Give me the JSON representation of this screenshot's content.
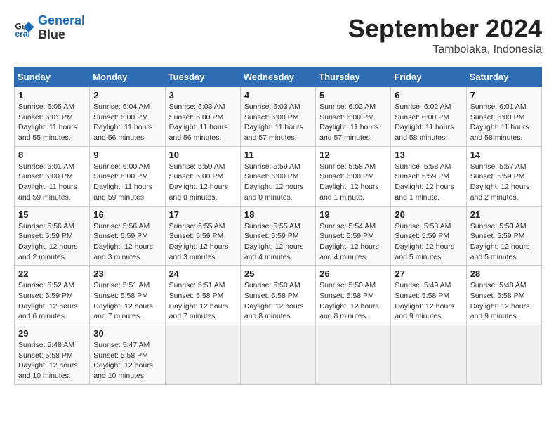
{
  "header": {
    "logo_line1": "General",
    "logo_line2": "Blue",
    "month": "September 2024",
    "location": "Tambolaka, Indonesia"
  },
  "weekdays": [
    "Sunday",
    "Monday",
    "Tuesday",
    "Wednesday",
    "Thursday",
    "Friday",
    "Saturday"
  ],
  "weeks": [
    [
      {
        "day": "1",
        "info": "Sunrise: 6:05 AM\nSunset: 6:01 PM\nDaylight: 11 hours\nand 55 minutes."
      },
      {
        "day": "2",
        "info": "Sunrise: 6:04 AM\nSunset: 6:00 PM\nDaylight: 11 hours\nand 56 minutes."
      },
      {
        "day": "3",
        "info": "Sunrise: 6:03 AM\nSunset: 6:00 PM\nDaylight: 11 hours\nand 56 minutes."
      },
      {
        "day": "4",
        "info": "Sunrise: 6:03 AM\nSunset: 6:00 PM\nDaylight: 11 hours\nand 57 minutes."
      },
      {
        "day": "5",
        "info": "Sunrise: 6:02 AM\nSunset: 6:00 PM\nDaylight: 11 hours\nand 57 minutes."
      },
      {
        "day": "6",
        "info": "Sunrise: 6:02 AM\nSunset: 6:00 PM\nDaylight: 11 hours\nand 58 minutes."
      },
      {
        "day": "7",
        "info": "Sunrise: 6:01 AM\nSunset: 6:00 PM\nDaylight: 11 hours\nand 58 minutes."
      }
    ],
    [
      {
        "day": "8",
        "info": "Sunrise: 6:01 AM\nSunset: 6:00 PM\nDaylight: 11 hours\nand 59 minutes."
      },
      {
        "day": "9",
        "info": "Sunrise: 6:00 AM\nSunset: 6:00 PM\nDaylight: 11 hours\nand 59 minutes."
      },
      {
        "day": "10",
        "info": "Sunrise: 5:59 AM\nSunset: 6:00 PM\nDaylight: 12 hours\nand 0 minutes."
      },
      {
        "day": "11",
        "info": "Sunrise: 5:59 AM\nSunset: 6:00 PM\nDaylight: 12 hours\nand 0 minutes."
      },
      {
        "day": "12",
        "info": "Sunrise: 5:58 AM\nSunset: 6:00 PM\nDaylight: 12 hours\nand 1 minute."
      },
      {
        "day": "13",
        "info": "Sunrise: 5:58 AM\nSunset: 5:59 PM\nDaylight: 12 hours\nand 1 minute."
      },
      {
        "day": "14",
        "info": "Sunrise: 5:57 AM\nSunset: 5:59 PM\nDaylight: 12 hours\nand 2 minutes."
      }
    ],
    [
      {
        "day": "15",
        "info": "Sunrise: 5:56 AM\nSunset: 5:59 PM\nDaylight: 12 hours\nand 2 minutes."
      },
      {
        "day": "16",
        "info": "Sunrise: 5:56 AM\nSunset: 5:59 PM\nDaylight: 12 hours\nand 3 minutes."
      },
      {
        "day": "17",
        "info": "Sunrise: 5:55 AM\nSunset: 5:59 PM\nDaylight: 12 hours\nand 3 minutes."
      },
      {
        "day": "18",
        "info": "Sunrise: 5:55 AM\nSunset: 5:59 PM\nDaylight: 12 hours\nand 4 minutes."
      },
      {
        "day": "19",
        "info": "Sunrise: 5:54 AM\nSunset: 5:59 PM\nDaylight: 12 hours\nand 4 minutes."
      },
      {
        "day": "20",
        "info": "Sunrise: 5:53 AM\nSunset: 5:59 PM\nDaylight: 12 hours\nand 5 minutes."
      },
      {
        "day": "21",
        "info": "Sunrise: 5:53 AM\nSunset: 5:59 PM\nDaylight: 12 hours\nand 5 minutes."
      }
    ],
    [
      {
        "day": "22",
        "info": "Sunrise: 5:52 AM\nSunset: 5:59 PM\nDaylight: 12 hours\nand 6 minutes."
      },
      {
        "day": "23",
        "info": "Sunrise: 5:51 AM\nSunset: 5:58 PM\nDaylight: 12 hours\nand 7 minutes."
      },
      {
        "day": "24",
        "info": "Sunrise: 5:51 AM\nSunset: 5:58 PM\nDaylight: 12 hours\nand 7 minutes."
      },
      {
        "day": "25",
        "info": "Sunrise: 5:50 AM\nSunset: 5:58 PM\nDaylight: 12 hours\nand 8 minutes."
      },
      {
        "day": "26",
        "info": "Sunrise: 5:50 AM\nSunset: 5:58 PM\nDaylight: 12 hours\nand 8 minutes."
      },
      {
        "day": "27",
        "info": "Sunrise: 5:49 AM\nSunset: 5:58 PM\nDaylight: 12 hours\nand 9 minutes."
      },
      {
        "day": "28",
        "info": "Sunrise: 5:48 AM\nSunset: 5:58 PM\nDaylight: 12 hours\nand 9 minutes."
      }
    ],
    [
      {
        "day": "29",
        "info": "Sunrise: 5:48 AM\nSunset: 5:58 PM\nDaylight: 12 hours\nand 10 minutes."
      },
      {
        "day": "30",
        "info": "Sunrise: 5:47 AM\nSunset: 5:58 PM\nDaylight: 12 hours\nand 10 minutes."
      },
      {
        "day": "",
        "info": ""
      },
      {
        "day": "",
        "info": ""
      },
      {
        "day": "",
        "info": ""
      },
      {
        "day": "",
        "info": ""
      },
      {
        "day": "",
        "info": ""
      }
    ]
  ]
}
